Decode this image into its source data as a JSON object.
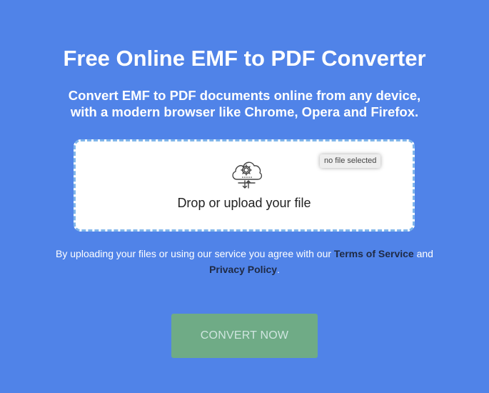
{
  "header": {
    "title": "Free Online EMF to PDF Converter",
    "subtitle_line1": "Convert EMF to PDF documents online from any device,",
    "subtitle_line2": "with a modern browser like Chrome, Opera and Firefox."
  },
  "dropzone": {
    "label": "Drop or upload your file",
    "file_status": "no file selected",
    "icon": "cloud-gear-upload-icon"
  },
  "agreement": {
    "text_before": "By uploading your files or using our service you agree with our ",
    "terms_link": "Terms of Service",
    "text_middle": " and",
    "privacy_link": "Privacy Policy",
    "text_after": "."
  },
  "actions": {
    "convert_label": "CONVERT NOW"
  },
  "colors": {
    "background": "#5083e8",
    "dropzone_border": "#7fb5ea",
    "button": "#6fab86",
    "link": "#1f2a44"
  }
}
